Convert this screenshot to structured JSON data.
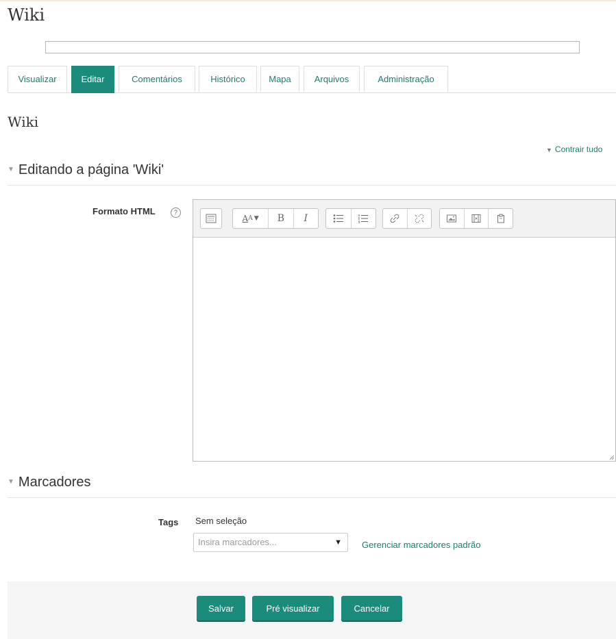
{
  "page": {
    "title": "Wiki",
    "heading": "Wiki"
  },
  "title_input": {
    "value": ""
  },
  "tabs": [
    {
      "label": "Visualizar",
      "active": false
    },
    {
      "label": "Editar",
      "active": true
    },
    {
      "label": "Comentários",
      "active": false
    },
    {
      "label": "Histórico",
      "active": false
    },
    {
      "label": "Mapa",
      "active": false
    },
    {
      "label": "Arquivos",
      "active": false
    },
    {
      "label": "Administração",
      "active": false
    }
  ],
  "collapse_all": "Contrair tudo",
  "sections": {
    "edit": {
      "legend": "Editando a página 'Wiki'"
    },
    "tags": {
      "legend": "Marcadores"
    }
  },
  "editor": {
    "label": "Formato HTML",
    "help_icon": "question-circle-icon",
    "content": "",
    "toolbar_icons": [
      "toolbar-toggle-icon",
      "font-style-icon",
      "bold-icon",
      "italic-icon",
      "unordered-list-icon",
      "ordered-list-icon",
      "link-icon",
      "unlink-icon",
      "image-icon",
      "media-icon",
      "manage-files-icon"
    ]
  },
  "tags": {
    "label": "Tags",
    "selection": "Sem seleção",
    "placeholder": "Insira marcadores...",
    "manage_link": "Gerenciar marcadores padrão"
  },
  "buttons": {
    "save": "Salvar",
    "preview": "Pré visualizar",
    "cancel": "Cancelar"
  },
  "colors": {
    "accent": "#1b8c7b",
    "link": "#1a7e71",
    "footer_bg": "#f5f5f5"
  }
}
